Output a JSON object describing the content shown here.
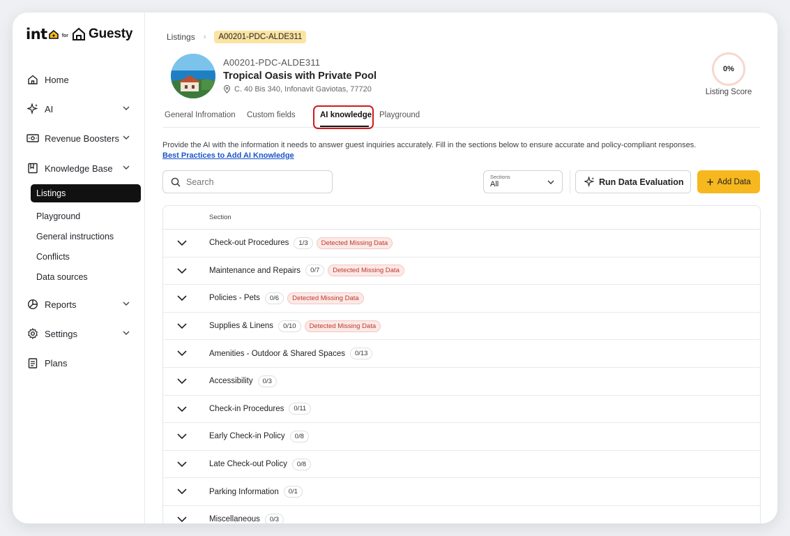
{
  "brand": {
    "into": "int",
    "for": "for",
    "guesty": "Guesty"
  },
  "sidebar": {
    "items": [
      {
        "label": "Home"
      },
      {
        "label": "AI"
      },
      {
        "label": "Revenue Boosters"
      },
      {
        "label": "Knowledge Base"
      },
      {
        "label": "Reports"
      },
      {
        "label": "Settings"
      },
      {
        "label": "Plans"
      }
    ],
    "knowledge_sub": [
      {
        "label": "Listings"
      },
      {
        "label": "Playground"
      },
      {
        "label": "General instructions"
      },
      {
        "label": "Conflicts"
      },
      {
        "label": "Data sources"
      }
    ]
  },
  "breadcrumb": {
    "root": "Listings",
    "current": "A00201-PDC-ALDE311"
  },
  "listing": {
    "id": "A00201-PDC-ALDE311",
    "title": "Tropical Oasis with Private Pool",
    "address": "C. 40 Bis 340, Infonavit Gaviotas, 77720"
  },
  "score": {
    "value": "0%",
    "label": "Listing Score"
  },
  "tabs": [
    {
      "label": "General Infromation"
    },
    {
      "label": "Custom fields"
    },
    {
      "label": "AI knowledge"
    },
    {
      "label": "Playground"
    }
  ],
  "intro": {
    "text": "Provide the AI with the information it needs to answer guest inquiries accurately. Fill in the sections below to ensure accurate and policy-compliant responses.",
    "link": "Best Practices to Add AI Knowledge"
  },
  "search": {
    "placeholder": "Search"
  },
  "sections_select": {
    "label": "Sections",
    "value": "All"
  },
  "buttons": {
    "run_eval": "Run Data Evaluation",
    "add_data": "Add Data"
  },
  "table": {
    "header": "Section",
    "missing_label": "Detected Missing Data",
    "rows": [
      {
        "name": "Check-out Procedures",
        "count": "1/3",
        "missing": "Detected Missing Data"
      },
      {
        "name": "Maintenance and Repairs",
        "count": "0/7",
        "missing": "Detected Missing Data"
      },
      {
        "name": "Policies - Pets",
        "count": "0/6",
        "missing": "Detected Missing Data"
      },
      {
        "name": "Supplies & Linens",
        "count": "0/10",
        "missing": "Detected Missing Data"
      },
      {
        "name": "Amenities - Outdoor & Shared Spaces",
        "count": "0/13",
        "missing": ""
      },
      {
        "name": "Accessibility",
        "count": "0/3",
        "missing": ""
      },
      {
        "name": "Check-in Procedures",
        "count": "0/11",
        "missing": ""
      },
      {
        "name": "Early Check-in Policy",
        "count": "0/8",
        "missing": ""
      },
      {
        "name": "Late Check-out Policy",
        "count": "0/8",
        "missing": ""
      },
      {
        "name": "Parking Information",
        "count": "0/1",
        "missing": ""
      },
      {
        "name": "Miscellaneous",
        "count": "0/3",
        "missing": ""
      }
    ]
  },
  "colors": {
    "accent": "#f6b81e",
    "active_nav": "#111111",
    "missing_red": "#c0392b",
    "highlight": "#d11a1a"
  }
}
